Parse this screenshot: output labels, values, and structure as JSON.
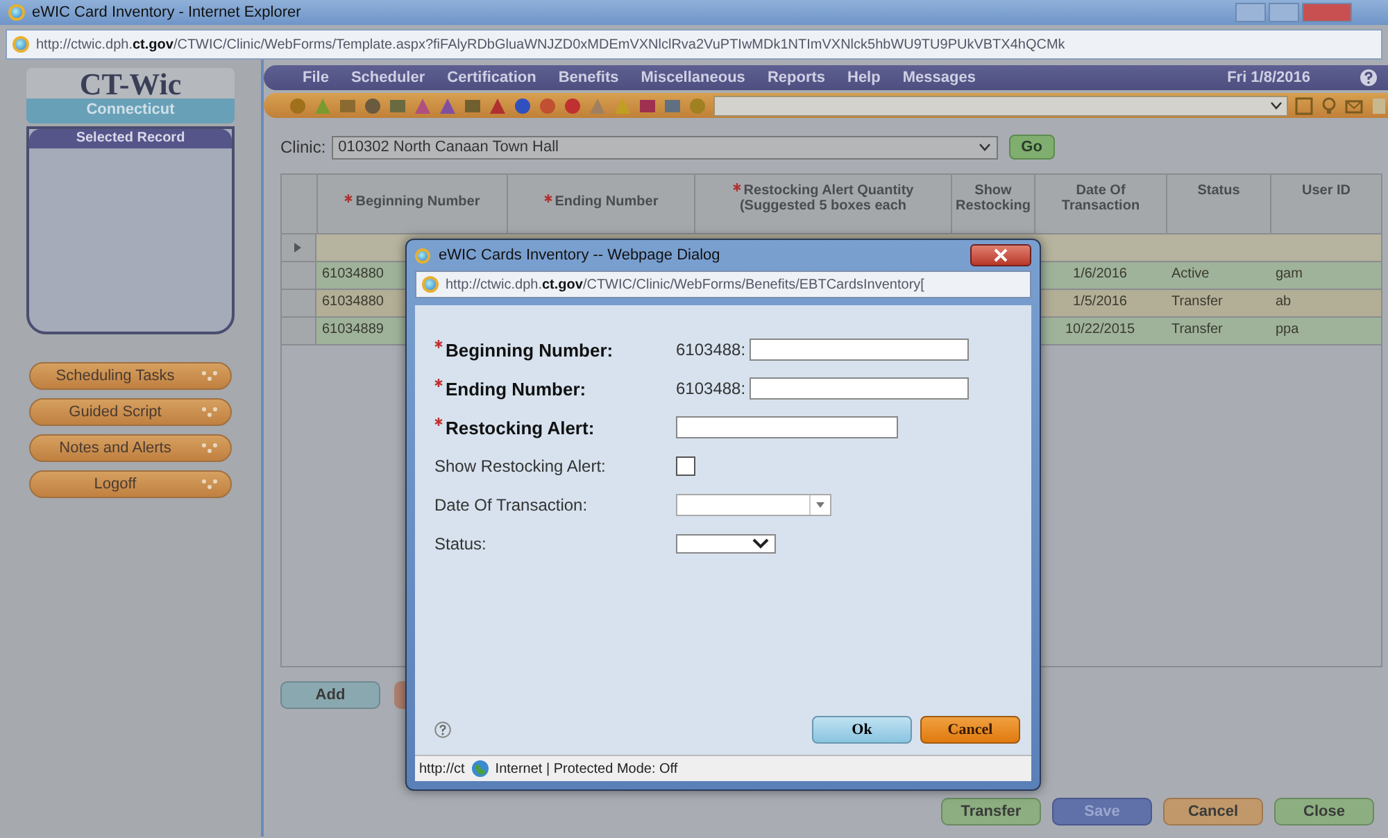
{
  "window": {
    "title": "eWIC Card Inventory - Internet Explorer",
    "address": "http://ctwic.dph.**ct.gov**/CTWIC/Clinic/WebForms/Template.aspx?fiFAlyRDbGluaWNJZD0xMDEmVXNlclRva2VuPTIwMDk1NTImVXNlck5hbWU9TU9PUkVBTX4hQCMk"
  },
  "logo": {
    "title": "CT-Wic",
    "subtitle": "Connecticut"
  },
  "menu": [
    {
      "label": "File"
    },
    {
      "label": "Scheduler"
    },
    {
      "label": "Certification"
    },
    {
      "label": "Benefits"
    },
    {
      "label": "Miscellaneous"
    },
    {
      "label": "Reports"
    },
    {
      "label": "Help"
    },
    {
      "label": "Messages"
    }
  ],
  "date": "Fri 1/8/2016",
  "sidebar": {
    "panel_title": "Selected Record",
    "items": [
      {
        "label": "Scheduling Tasks"
      },
      {
        "label": "Guided Script"
      },
      {
        "label": "Notes and Alerts"
      },
      {
        "label": "Logoff"
      }
    ]
  },
  "clinic": {
    "label": "Clinic:",
    "value": "010302 North Canaan Town Hall",
    "button": "Go"
  },
  "table": {
    "columns": [
      {
        "label": "Beginning Number",
        "required": true
      },
      {
        "label": "Ending Number",
        "required": true
      },
      {
        "label": "Restocking Alert Quantity (Suggested 5 boxes each",
        "required": true
      },
      {
        "label": "Show Restocking",
        "required": false
      },
      {
        "label": "Date Of Transaction",
        "required": false
      },
      {
        "label": "Status",
        "required": false
      },
      {
        "label": "User ID",
        "required": false
      }
    ],
    "rows": [
      {
        "kind": "new",
        "cells": []
      },
      {
        "kind": "active",
        "cells": [
          "61034880",
          "1/6/2016",
          "Active",
          "gam"
        ]
      },
      {
        "kind": "transfer",
        "cells": [
          "61034880",
          "1/5/2016",
          "Transfer",
          "ab"
        ]
      },
      {
        "kind": "active",
        "cells": [
          "61034889",
          "10/22/2015",
          "Transfer",
          "ppa"
        ]
      }
    ]
  },
  "add_button": "Add",
  "footer_buttons": [
    {
      "label": "Transfer",
      "kind": "green"
    },
    {
      "label": "Save",
      "kind": "blue"
    },
    {
      "label": "Cancel",
      "kind": "orange"
    },
    {
      "label": "Close",
      "kind": "green"
    }
  ],
  "dialog": {
    "title": "eWIC Cards Inventory -- Webpage Dialog",
    "address": "http://ctwic.dph.**ct.gov**/CTWIC/Clinic/WebForms/Benefits/EBTCardsInventory[",
    "fields": [
      {
        "kind": "prefixed",
        "label": "Beginning Number:",
        "required": true,
        "prefix": "6103488:"
      },
      {
        "kind": "prefixed",
        "label": "Ending Number:",
        "required": true,
        "prefix": "6103488:"
      },
      {
        "kind": "text",
        "label": "Restocking Alert:",
        "required": true
      },
      {
        "kind": "checkbox",
        "label": "Show Restocking Alert:",
        "required": false,
        "checked": false
      },
      {
        "kind": "date",
        "label": "Date Of Transaction:",
        "required": false
      },
      {
        "kind": "select",
        "label": "Status:",
        "required": false
      }
    ],
    "ok": "Ok",
    "cancel": "Cancel",
    "status_url": "http://ct",
    "status_text": "Internet | Protected Mode: Off"
  }
}
